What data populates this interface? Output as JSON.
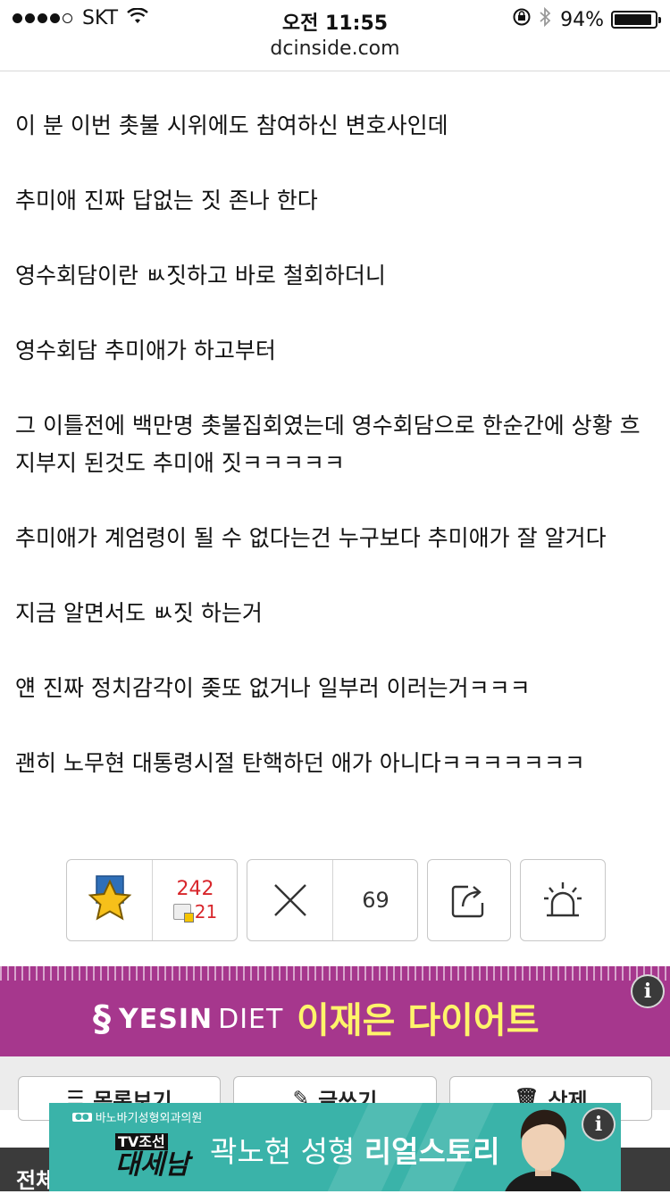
{
  "status_bar": {
    "carrier": "SKT",
    "time": "오전 11:55",
    "battery": "94%",
    "battery_level": 0.94
  },
  "browser": {
    "url": "dcinside.com"
  },
  "article": {
    "paragraphs": [
      "이 분 이번 촛불 시위에도 참여하신 변호사인데",
      "추미애 진짜 답없는 짓 존나 한다",
      "영수회담이란 ㅄ짓하고 바로 철회하더니",
      "영수회담 추미애가 하고부터",
      "그 이틀전에 백만명 촛불집회였는데 영수회담으로 한순간에 상황 흐지부지 된것도 추미애 짓ㅋㅋㅋㅋㅋ",
      "추미애가 계엄령이 될 수 없다는건 누구보다 추미애가 잘 알거다",
      "지금 알면서도 ㅄ짓 하는거",
      "얜 진짜 정치감각이 좆또 없거나 일부러 이러는거ㅋㅋㅋ",
      "괜히 노무현 대통령시절 탄핵하던 애가 아니다ㅋㅋㅋㅋㅋㅋㅋ"
    ]
  },
  "actions": {
    "recommend_count": "242",
    "fixed_recommend_count": "21",
    "nonrecommend_count": "69"
  },
  "banner_ad": {
    "brand_bold": "YESIN",
    "brand_light": " DIET",
    "slogan": "이재은 다이어트",
    "info": "i"
  },
  "bottom_buttons": {
    "list": "목록보기",
    "write": "글쓰기",
    "delete": "삭제"
  },
  "bottom_strip": {
    "label": "전체"
  },
  "overlay_ad": {
    "sponsor": "바노바기성형외과의원",
    "channel": "TV조선",
    "program": "대세남",
    "headline_plain": "곽노현 성형 ",
    "headline_bold": "리얼스토리",
    "info": "i"
  }
}
